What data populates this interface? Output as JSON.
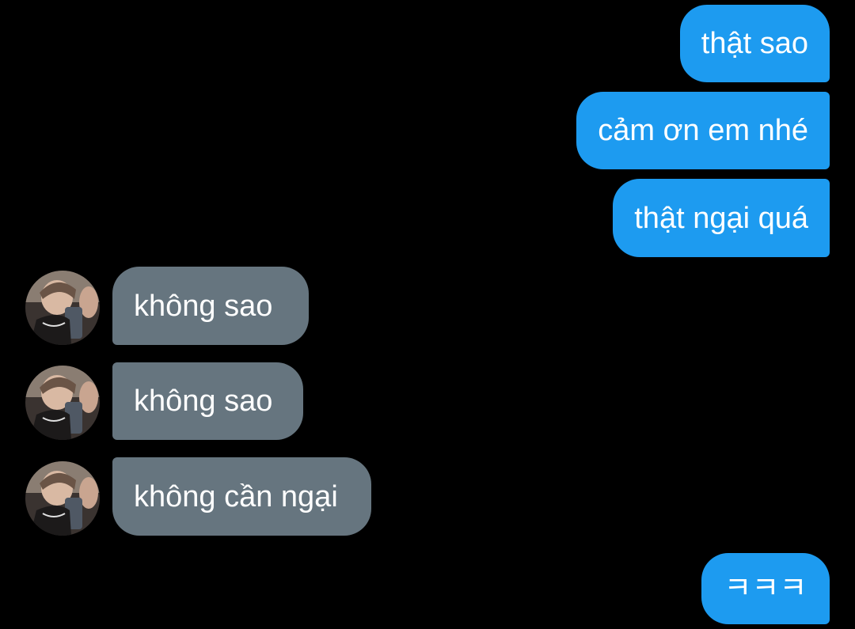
{
  "colors": {
    "background": "#000000",
    "sent_bubble": "#1d9bf0",
    "received_bubble": "#66757f",
    "text": "#ffffff"
  },
  "messages": [
    {
      "direction": "sent",
      "text": "thật sao"
    },
    {
      "direction": "sent",
      "text": "cảm ơn em nhé"
    },
    {
      "direction": "sent",
      "text": "thật ngại quá"
    },
    {
      "direction": "received",
      "text": "không sao",
      "avatar": "user-avatar-photo"
    },
    {
      "direction": "received",
      "text": "không sao",
      "avatar": "user-avatar-photo"
    },
    {
      "direction": "received",
      "text": "không cần ngại",
      "avatar": "user-avatar-photo"
    },
    {
      "direction": "sent",
      "text": "ㅋㅋㅋ"
    }
  ]
}
